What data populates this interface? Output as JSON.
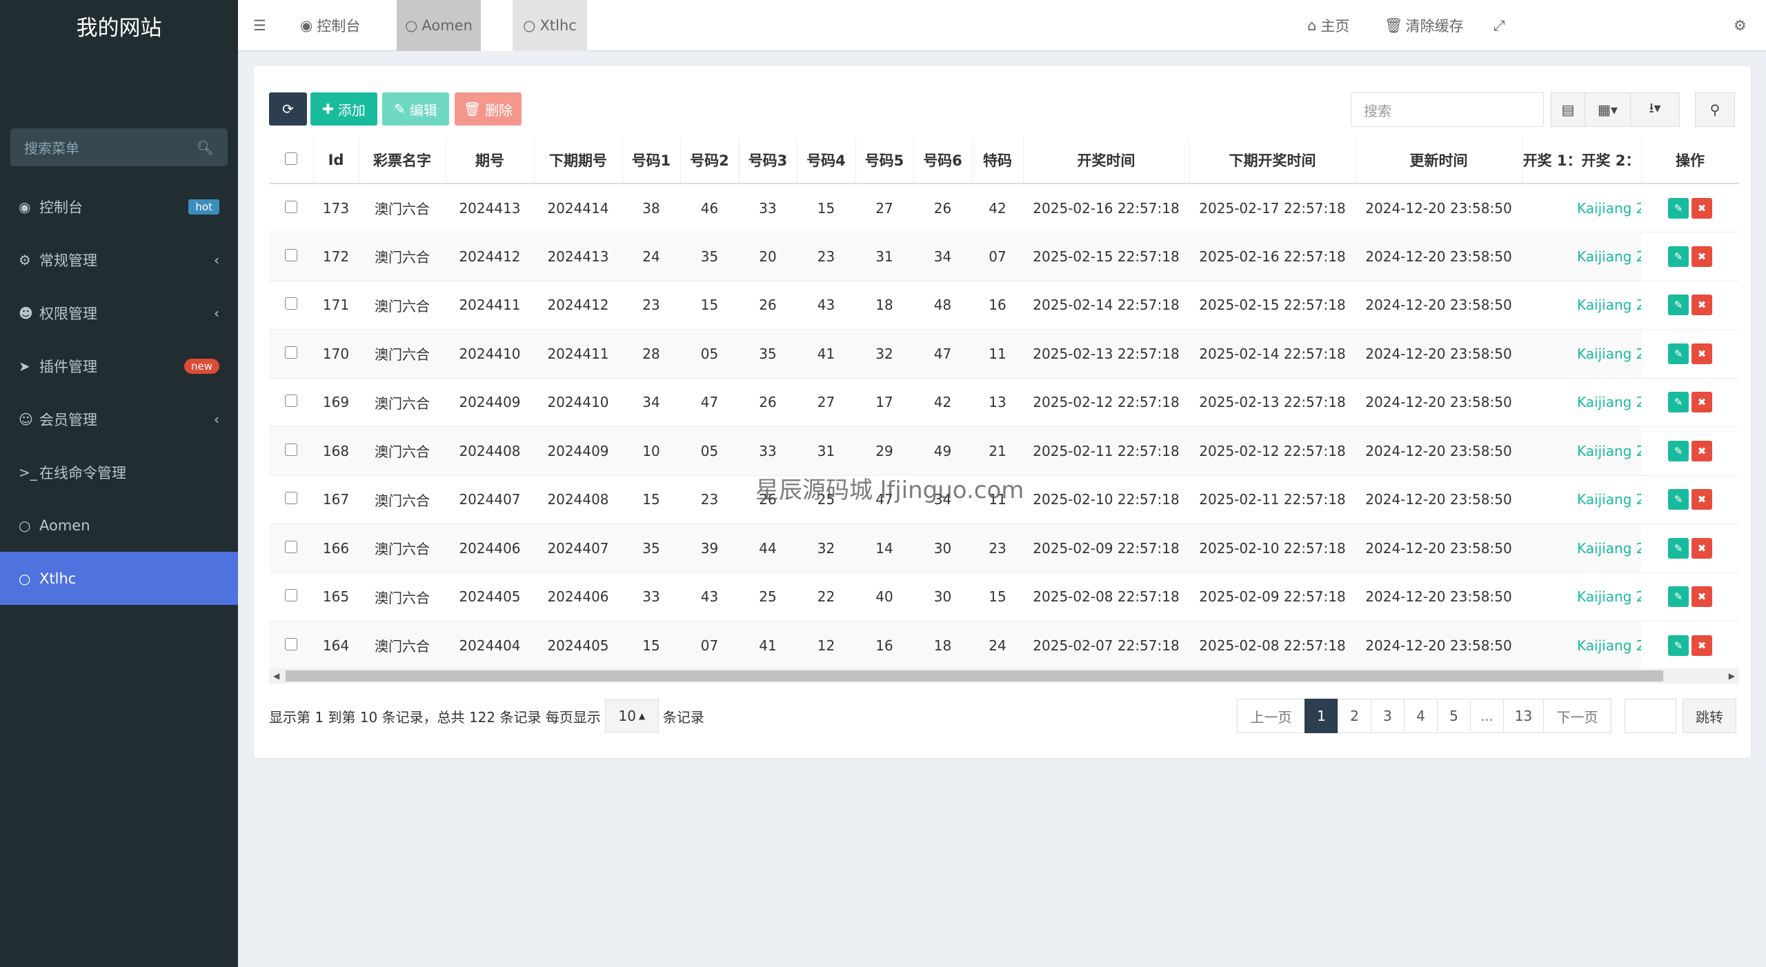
{
  "sidebar": {
    "logo": "我的网站",
    "search_placeholder": "搜索菜单",
    "items": [
      {
        "label": "控制台",
        "badge": "hot"
      },
      {
        "label": "常规管理"
      },
      {
        "label": "权限管理"
      },
      {
        "label": "插件管理",
        "badge": "new"
      },
      {
        "label": "会员管理"
      },
      {
        "label": "在线命令管理"
      },
      {
        "label": "Aomen"
      },
      {
        "label": "Xtlhc"
      }
    ]
  },
  "topbar": {
    "tabs": [
      "控制台",
      "Aomen",
      "Xtlhc"
    ],
    "home": "主页",
    "clear_cache": "清除缓存"
  },
  "toolbar": {
    "add": "添加",
    "edit": "编辑",
    "delete": "删除",
    "search_placeholder": "搜索"
  },
  "table": {
    "headers": [
      "Id",
      "彩票名字",
      "期号",
      "下期期号",
      "号码1",
      "号码2",
      "号码3",
      "号码4",
      "号码5",
      "号码6",
      "特码",
      "开奖时间",
      "下期开奖时间",
      "更新时间",
      "开奖 1：开奖 2：",
      "操作"
    ],
    "rows": [
      [
        "173",
        "澳门六合",
        "2024413",
        "2024414",
        "38",
        "46",
        "33",
        "15",
        "27",
        "26",
        "42",
        "2025-02-16 22:57:18",
        "2025-02-17 22:57:18",
        "2024-12-20 23:58:50",
        "Kaijiang 2"
      ],
      [
        "172",
        "澳门六合",
        "2024412",
        "2024413",
        "24",
        "35",
        "20",
        "23",
        "31",
        "34",
        "07",
        "2025-02-15 22:57:18",
        "2025-02-16 22:57:18",
        "2024-12-20 23:58:50",
        "Kaijiang 2"
      ],
      [
        "171",
        "澳门六合",
        "2024411",
        "2024412",
        "23",
        "15",
        "26",
        "43",
        "18",
        "48",
        "16",
        "2025-02-14 22:57:18",
        "2025-02-15 22:57:18",
        "2024-12-20 23:58:50",
        "Kaijiang 2"
      ],
      [
        "170",
        "澳门六合",
        "2024410",
        "2024411",
        "28",
        "05",
        "35",
        "41",
        "32",
        "47",
        "11",
        "2025-02-13 22:57:18",
        "2025-02-14 22:57:18",
        "2024-12-20 23:58:50",
        "Kaijiang 2"
      ],
      [
        "169",
        "澳门六合",
        "2024409",
        "2024410",
        "34",
        "47",
        "26",
        "27",
        "17",
        "42",
        "13",
        "2025-02-12 22:57:18",
        "2025-02-13 22:57:18",
        "2024-12-20 23:58:50",
        "Kaijiang 2"
      ],
      [
        "168",
        "澳门六合",
        "2024408",
        "2024409",
        "10",
        "05",
        "33",
        "31",
        "29",
        "49",
        "21",
        "2025-02-11 22:57:18",
        "2025-02-12 22:57:18",
        "2024-12-20 23:58:50",
        "Kaijiang 2"
      ],
      [
        "167",
        "澳门六合",
        "2024407",
        "2024408",
        "15",
        "23",
        "26",
        "25",
        "47",
        "34",
        "11",
        "2025-02-10 22:57:18",
        "2025-02-11 22:57:18",
        "2024-12-20 23:58:50",
        "Kaijiang 2"
      ],
      [
        "166",
        "澳门六合",
        "2024406",
        "2024407",
        "35",
        "39",
        "44",
        "32",
        "14",
        "30",
        "23",
        "2025-02-09 22:57:18",
        "2025-02-10 22:57:18",
        "2024-12-20 23:58:50",
        "Kaijiang 2"
      ],
      [
        "165",
        "澳门六合",
        "2024405",
        "2024406",
        "33",
        "43",
        "25",
        "22",
        "40",
        "30",
        "15",
        "2025-02-08 22:57:18",
        "2025-02-09 22:57:18",
        "2024-12-20 23:58:50",
        "Kaijiang 2"
      ],
      [
        "164",
        "澳门六合",
        "2024404",
        "2024405",
        "15",
        "07",
        "41",
        "12",
        "16",
        "18",
        "24",
        "2025-02-07 22:57:18",
        "2025-02-08 22:57:18",
        "2024-12-20 23:58:50",
        "Kaijiang 2"
      ]
    ]
  },
  "footer": {
    "info": "显示第 1 到第 10 条记录，总共 122 条记录 每页显示",
    "page_size": "10",
    "info_suffix": "条记录",
    "pages": [
      "上一页",
      "1",
      "2",
      "3",
      "4",
      "5",
      "...",
      "13",
      "下一页"
    ],
    "jump": "跳转"
  },
  "watermark": "星辰源码城  lfjinguo.com",
  "colors": {
    "sidebar_bg": "#222d32",
    "sidebar_active": "#4e73df",
    "accent_green": "#18bc9c",
    "danger": "#e74c3c",
    "dark_btn": "#2c3e50"
  }
}
